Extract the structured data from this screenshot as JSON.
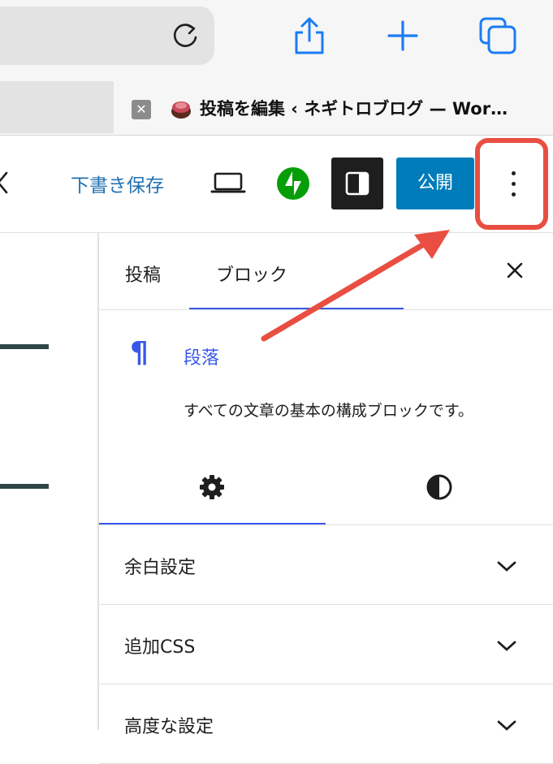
{
  "browser": {
    "tab_close_glyph": "✕",
    "tab_title": "投稿を編集 ‹ ネギトロブログ — Wor…",
    "icons": [
      "reload-icon",
      "share-icon",
      "new-tab-icon",
      "tabs-icon"
    ]
  },
  "editor_header": {
    "save_draft_label": "下書き保存",
    "publish_label": "公開",
    "icons": [
      "back-chevron-icon",
      "preview-laptop-icon",
      "jetpack-icon",
      "settings-sidebar-icon",
      "more-options-icon"
    ]
  },
  "sidebar": {
    "tabs": {
      "post_label": "投稿",
      "block_label": "ブロック"
    },
    "block_card": {
      "icon": "¶",
      "name": "段落",
      "description": "すべての文章の基本の構成ブロックです。"
    },
    "panels": [
      {
        "label": "余白設定"
      },
      {
        "label": "追加CSS"
      },
      {
        "label": "高度な設定"
      }
    ]
  },
  "colors": {
    "accent": "#3858e9",
    "publish": "#007cba",
    "save_draft": "#2271b1",
    "annotation": "#e94e42",
    "jetpack": "#069e08"
  }
}
